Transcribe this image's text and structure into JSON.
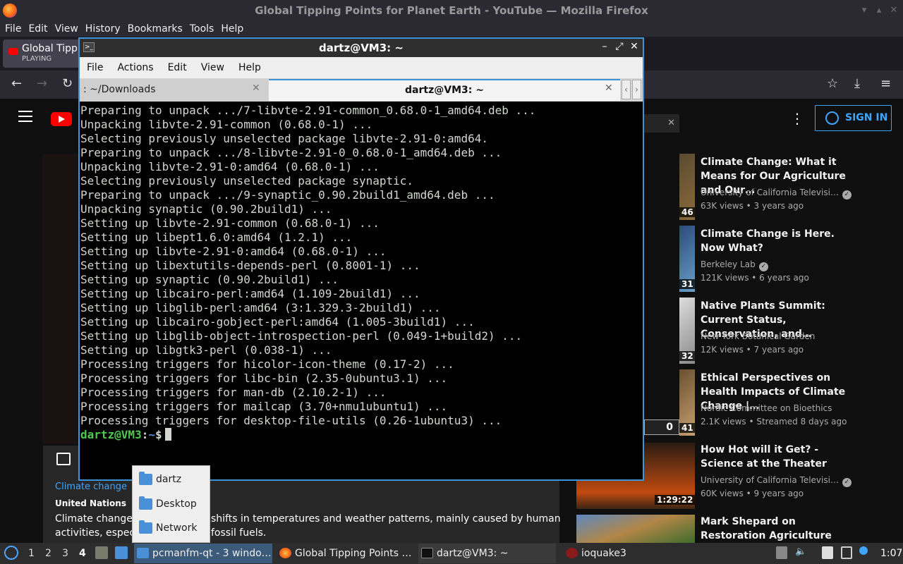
{
  "firefox": {
    "window_title": "Global Tipping Points for Planet Earth - YouTube — Mozilla Firefox",
    "menu": [
      "File",
      "Edit",
      "View",
      "History",
      "Bookmarks",
      "Tools",
      "Help"
    ],
    "tab": {
      "title": "Global Tipping Points for Planet Earth",
      "status": "PLAYING"
    }
  },
  "youtube": {
    "sign_in": "SIGN IN",
    "overlay_close": "✕",
    "description": {
      "link": "Climate change",
      "org": "United Nations",
      "text_left": "Climate change re",
      "text_right": "shifts in temperatures and weather patterns, mainly caused by human",
      "text2_left": "activities, especia",
      "text2_right": "fossil fuels."
    },
    "player_counter": "0",
    "related": [
      {
        "title": "Climate Change: What it Means for Our Agriculture and Our…",
        "channel": "University of California Televisi…",
        "verified": true,
        "meta": "63K views • 3 years ago",
        "duration": "46"
      },
      {
        "title": "Climate Change is Here. Now What?",
        "channel": "Berkeley Lab",
        "verified": true,
        "meta": "121K views • 6 years ago",
        "duration": "31"
      },
      {
        "title": "Native Plants Summit: Current Status, Conservation, and…",
        "channel": "New York Botanical Garden",
        "verified": false,
        "meta": "12K views • 7 years ago",
        "duration": "32"
      },
      {
        "title": "Ethical Perspectives on Health Impacts of Climate Change |…",
        "channel": "Nordic Committee on Bioethics",
        "verified": false,
        "meta": "2.1K views • Streamed 8 days ago",
        "duration": "41"
      },
      {
        "title": "How Hot will it Get? - Science at the Theater",
        "channel": "University of California Televisi…",
        "verified": true,
        "meta": "60K views • 9 years ago",
        "duration": "1:29:22"
      },
      {
        "title": "Mark Shepard on Restoration Agriculture",
        "channel": "",
        "verified": false,
        "meta": "",
        "duration": ""
      }
    ]
  },
  "terminal": {
    "window_title": "dartz@VM3: ~",
    "menu": [
      "File",
      "Actions",
      "Edit",
      "View",
      "Help"
    ],
    "tabs": [
      {
        "label": ": ~/Downloads",
        "active": false
      },
      {
        "label": "dartz@VM3: ~",
        "active": true
      }
    ],
    "output": "Preparing to unpack .../7-libvte-2.91-common_0.68.0-1_amd64.deb ...\nUnpacking libvte-2.91-common (0.68.0-1) ...\nSelecting previously unselected package libvte-2.91-0:amd64.\nPreparing to unpack .../8-libvte-2.91-0_0.68.0-1_amd64.deb ...\nUnpacking libvte-2.91-0:amd64 (0.68.0-1) ...\nSelecting previously unselected package synaptic.\nPreparing to unpack .../9-synaptic_0.90.2build1_amd64.deb ...\nUnpacking synaptic (0.90.2build1) ...\nSetting up libvte-2.91-common (0.68.0-1) ...\nSetting up libept1.6.0:amd64 (1.2.1) ...\nSetting up libvte-2.91-0:amd64 (0.68.0-1) ...\nSetting up libextutils-depends-perl (0.8001-1) ...\nSetting up synaptic (0.90.2build1) ...\nSetting up libcairo-perl:amd64 (1.109-2build1) ...\nSetting up libglib-perl:amd64 (3:1.329.3-2build1) ...\nSetting up libcairo-gobject-perl:amd64 (1.005-3build1) ...\nSetting up libglib-object-introspection-perl (0.049-1+build2) ...\nSetting up libgtk3-perl (0.038-1) ...\nProcessing triggers for hicolor-icon-theme (0.17-2) ...\nProcessing triggers for libc-bin (2.35-0ubuntu3.1) ...\nProcessing triggers for man-db (2.10.2-1) ...\nProcessing triggers for mailcap (3.70+nmu1ubuntu1) ...\nProcessing triggers for desktop-file-utils (0.26-1ubuntu3) ...",
    "prompt_user": "dartz@VM3",
    "prompt_sep": ":",
    "prompt_path": "~",
    "prompt_sym": "$"
  },
  "folder_popup": [
    "dartz",
    "Desktop",
    "Network"
  ],
  "taskbar": {
    "workspaces": [
      "1",
      "2",
      "3",
      "4"
    ],
    "tasks": [
      "pcmanfm-qt - 3 windo…",
      "Global Tipping Points …",
      "dartz@VM3: ~",
      "ioquake3"
    ],
    "clock": "1:07"
  }
}
